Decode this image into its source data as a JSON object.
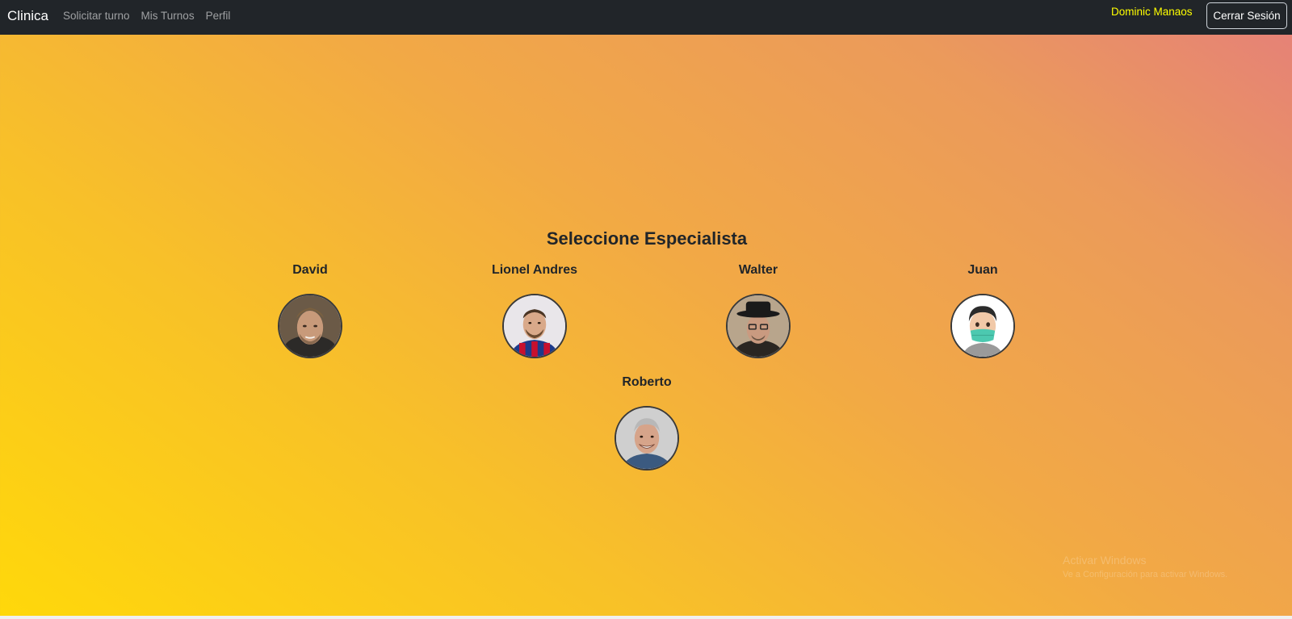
{
  "navbar": {
    "brand": "Clinica",
    "links": [
      {
        "label": "Solicitar turno"
      },
      {
        "label": "Mis Turnos"
      },
      {
        "label": "Perfil"
      }
    ],
    "user_name": "Dominic Manaos",
    "logout_label": "Cerrar Sesión",
    "user_name_color": "#ffff00"
  },
  "main": {
    "title": "Seleccione Especialista",
    "specialists": [
      {
        "name": "David",
        "avatar": "bearded-man-photo"
      },
      {
        "name": "Lionel Andres",
        "avatar": "footballer-photo"
      },
      {
        "name": "Walter",
        "avatar": "man-with-hat-photo"
      },
      {
        "name": "Juan",
        "avatar": "masked-memoji-avatar"
      },
      {
        "name": "Roberto",
        "avatar": "smiling-gray-hair-man-photo"
      }
    ]
  },
  "watermark": {
    "title": "Activar Windows",
    "subtitle": "Ve a Configuración para activar Windows."
  },
  "colors": {
    "navbar_bg": "#212529",
    "gradient_start": "#ffd80a",
    "gradient_end": "#e57f7a"
  }
}
